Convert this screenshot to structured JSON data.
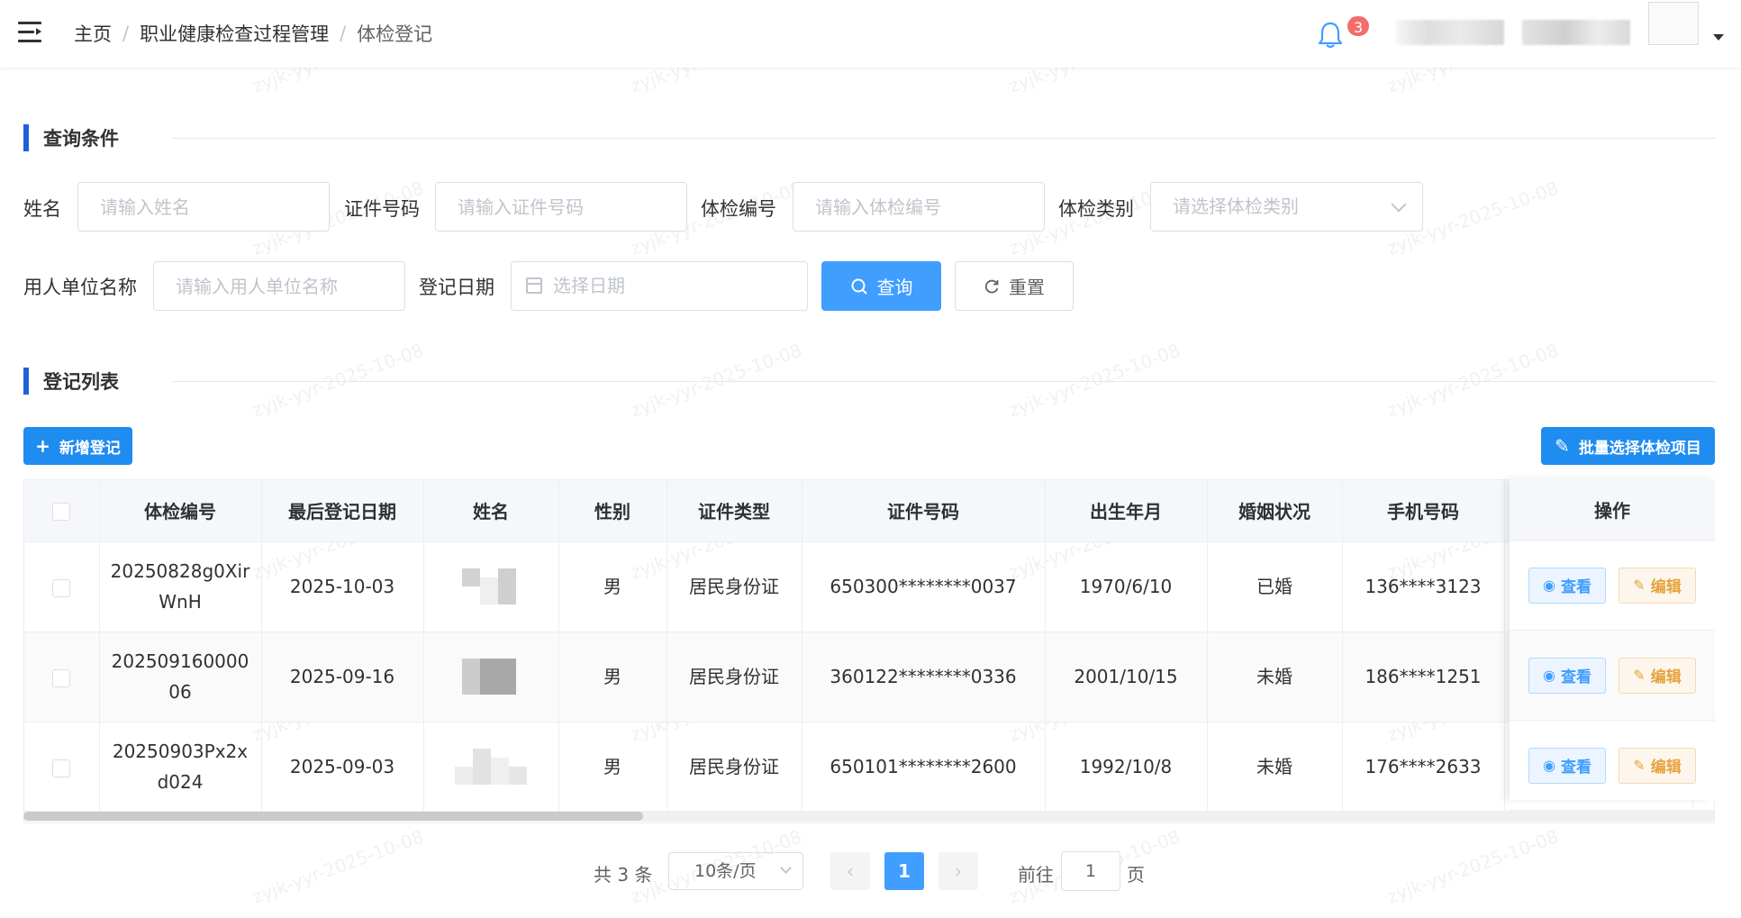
{
  "header": {
    "breadcrumb": [
      "主页",
      "职业健康检查过程管理",
      "体检登记"
    ],
    "notification_count": "3"
  },
  "query": {
    "title": "查询条件",
    "fields": {
      "name": {
        "label": "姓名",
        "placeholder": "请输入姓名"
      },
      "id_no": {
        "label": "证件号码",
        "placeholder": "请输入证件号码"
      },
      "exam_no": {
        "label": "体检编号",
        "placeholder": "请输入体检编号"
      },
      "exam_type": {
        "label": "体检类别",
        "placeholder": "请选择体检类别"
      },
      "employer": {
        "label": "用人单位名称",
        "placeholder": "请输入用人单位名称"
      },
      "reg_date": {
        "label": "登记日期",
        "placeholder": "选择日期"
      }
    },
    "search_label": "查询",
    "reset_label": "重置"
  },
  "list": {
    "title": "登记列表",
    "add_label": "新增登记",
    "batch_label": "批量选择体检项目",
    "columns": [
      "体检编号",
      "最后登记日期",
      "姓名",
      "性别",
      "证件类型",
      "证件号码",
      "出生年月",
      "婚姻状况",
      "手机号码",
      "操作"
    ],
    "rows": [
      {
        "exam_no": "20250828g0XirWnH",
        "date": "2025-10-03",
        "gender": "男",
        "id_type": "居民身份证",
        "id_no": "650300********0037",
        "birth": "1970/6/10",
        "marital": "已婚",
        "phone": "136****3123"
      },
      {
        "exam_no": "20250916000006",
        "date": "2025-09-16",
        "gender": "男",
        "id_type": "居民身份证",
        "id_no": "360122********0336",
        "birth": "2001/10/15",
        "marital": "未婚",
        "phone": "186****1251"
      },
      {
        "exam_no": "20250903Px2xd024",
        "date": "2025-09-03",
        "gender": "男",
        "id_type": "居民身份证",
        "id_no": "650101********2600",
        "birth": "1992/10/8",
        "marital": "未婚",
        "phone": "176****2633"
      }
    ],
    "view_label": "查看",
    "edit_label": "编辑"
  },
  "pagination": {
    "total": "共 3 条",
    "page_size": "10条/页",
    "current_page": "1",
    "goto_label": "前往",
    "goto_value": "1",
    "page_suffix": "页"
  },
  "watermark": "zyjk-yyr-2025-10-08",
  "colors": {
    "accent": "#409eff",
    "section_bar": "#1e63d6",
    "warning": "#e6a23c",
    "danger": "#f56c6c"
  }
}
